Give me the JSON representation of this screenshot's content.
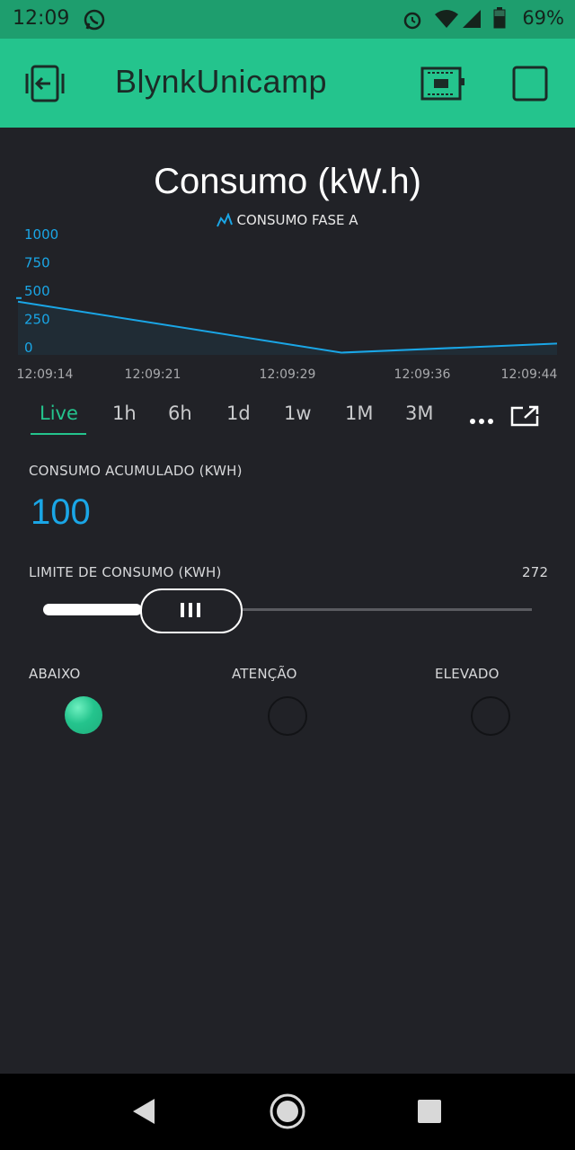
{
  "status_bar": {
    "time": "12:09",
    "battery": "69%",
    "icons": [
      "whatsapp-icon",
      "alarm-icon",
      "wifi-icon",
      "signal-icon",
      "battery-icon"
    ]
  },
  "app_bar": {
    "title": "BlynkUnicamp",
    "left_icon": "exit-icon",
    "right_icons": [
      "device-icon",
      "stop-icon"
    ]
  },
  "chart": {
    "title": "Consumo (kW.h)",
    "legend": "CONSUMO FASE A",
    "line_color": "#1aa6e6"
  },
  "chart_data": {
    "type": "area",
    "title": "Consumo (kW.h)",
    "series": [
      {
        "name": "CONSUMO FASE A",
        "x": [
          "12:09:14",
          "12:09:32",
          "12:09:44"
        ],
        "values": [
          470,
          20,
          100
        ]
      }
    ],
    "x_tick_labels": [
      "12:09:14",
      "12:09:21",
      "12:09:29",
      "12:09:36",
      "12:09:44"
    ],
    "y_tick_labels": [
      "1000",
      "750",
      "500",
      "250",
      "0"
    ],
    "ylim": [
      0,
      1000
    ],
    "grid": false
  },
  "time_range_tabs": {
    "items": [
      "Live",
      "1h",
      "6h",
      "1d",
      "1w",
      "1M",
      "3M"
    ],
    "active": "Live",
    "more_icon": "more-dots-icon",
    "export_icon": "expand-icon"
  },
  "accumulated": {
    "label": "CONSUMO ACUMULADO (KWH)",
    "value": "100"
  },
  "limit": {
    "label": "LIMITE DE CONSUMO (KWH)",
    "value": "272",
    "slider_fraction": 0.37
  },
  "leds": [
    {
      "label": "ABAIXO",
      "on": true,
      "color": "#24c48d"
    },
    {
      "label": "ATENÇÃO",
      "on": false,
      "color": "#24c48d"
    },
    {
      "label": "ELEVADO",
      "on": false,
      "color": "#24c48d"
    }
  ],
  "colors": {
    "accent": "#24c48d",
    "background": "#212227",
    "value_blue": "#1aa6e6"
  },
  "nav_bar": {
    "icons": [
      "back-icon",
      "home-icon",
      "recents-icon"
    ]
  }
}
